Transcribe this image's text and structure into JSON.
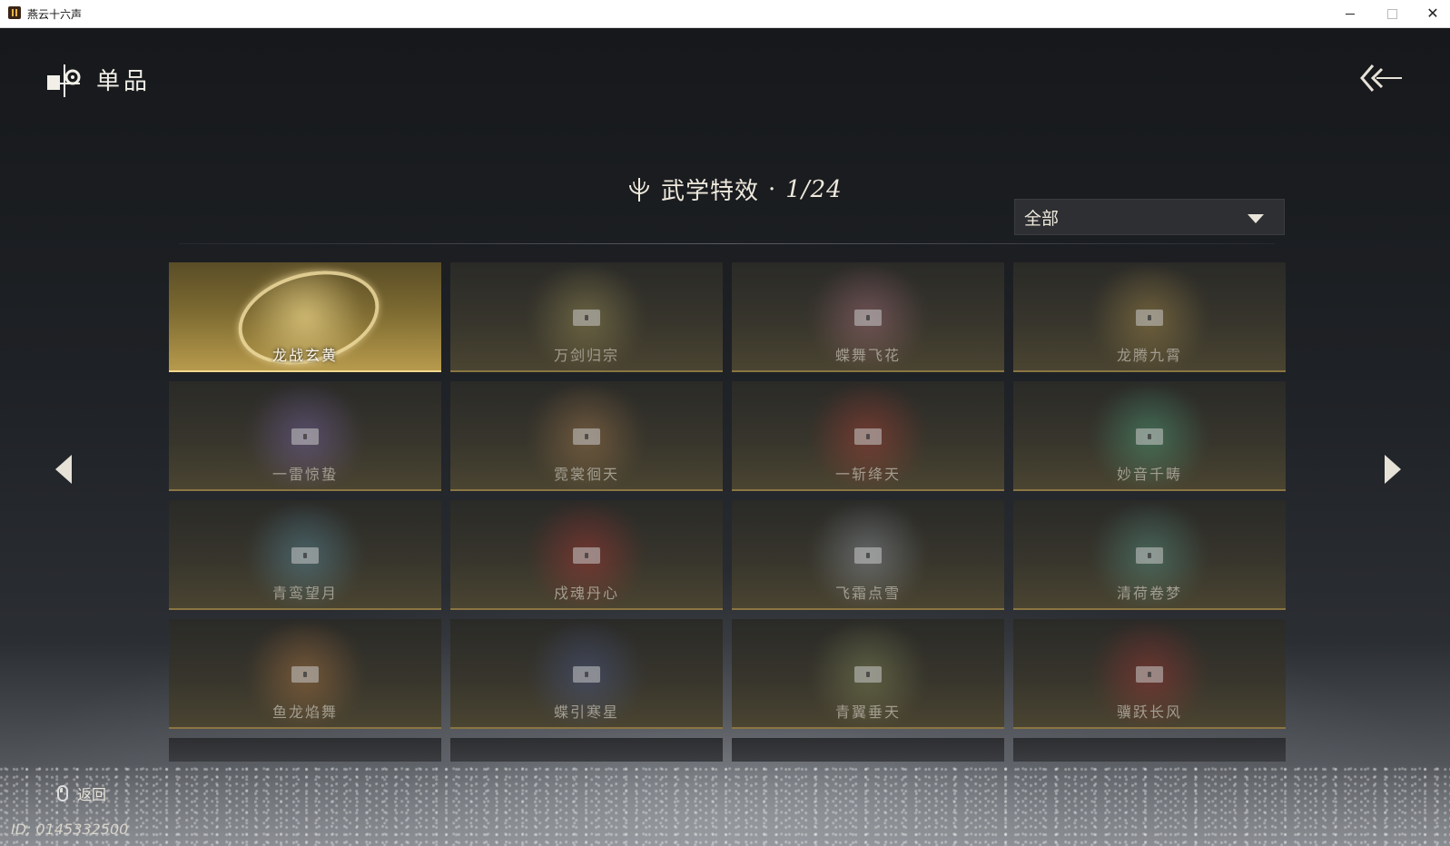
{
  "window": {
    "title": "燕云十六声",
    "minimize": "—",
    "maximize": "□",
    "close": "✕"
  },
  "header": {
    "title": "单品",
    "icon": "shop-bag-icon",
    "back_icon": "double-chevron-back-icon"
  },
  "section": {
    "title": "武学特效",
    "separator": "·",
    "count": "1/24",
    "icon": "lotus-ornament-icon"
  },
  "filter": {
    "selected": "全部"
  },
  "cards": [
    {
      "label": "龙战玄黄",
      "locked": false,
      "selected": true,
      "accent": "#d8c27a"
    },
    {
      "label": "万剑归宗",
      "locked": true,
      "selected": false,
      "accent": "#c9b86c"
    },
    {
      "label": "蝶舞飞花",
      "locked": true,
      "selected": false,
      "accent": "#d98aa0"
    },
    {
      "label": "龙腾九霄",
      "locked": true,
      "selected": false,
      "accent": "#d9b35c"
    },
    {
      "label": "一雷惊蛰",
      "locked": true,
      "selected": false,
      "accent": "#9a7fe0"
    },
    {
      "label": "霓裳徊天",
      "locked": true,
      "selected": false,
      "accent": "#d59a5e"
    },
    {
      "label": "一斩绛天",
      "locked": true,
      "selected": false,
      "accent": "#e0483c"
    },
    {
      "label": "妙音千畴",
      "locked": true,
      "selected": false,
      "accent": "#5fd6a4"
    },
    {
      "label": "青鸾望月",
      "locked": true,
      "selected": false,
      "accent": "#6fb8d6"
    },
    {
      "label": "戍魂丹心",
      "locked": true,
      "selected": false,
      "accent": "#e03a3a"
    },
    {
      "label": "飞霜点雪",
      "locked": true,
      "selected": false,
      "accent": "#b8c6d6"
    },
    {
      "label": "清荷卷梦",
      "locked": true,
      "selected": false,
      "accent": "#6cc2b0"
    },
    {
      "label": "鱼龙焰舞",
      "locked": true,
      "selected": false,
      "accent": "#e89850"
    },
    {
      "label": "蝶引寒星",
      "locked": true,
      "selected": false,
      "accent": "#5a6fb8"
    },
    {
      "label": "青翼垂天",
      "locked": true,
      "selected": false,
      "accent": "#a8b070"
    },
    {
      "label": "骥跃长风",
      "locked": true,
      "selected": false,
      "accent": "#d03a3a"
    }
  ],
  "footer": {
    "return_label": "返回",
    "player_id": "ID: 0145332500"
  }
}
